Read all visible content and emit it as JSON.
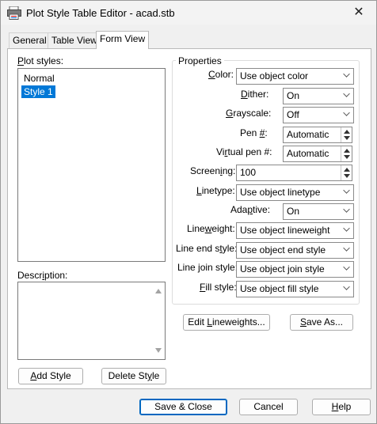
{
  "window": {
    "title": "Plot Style Table Editor - acad.stb",
    "close_glyph": "✕"
  },
  "tabs": [
    {
      "label": "General"
    },
    {
      "label": "Table View"
    },
    {
      "label": "Form View"
    }
  ],
  "plot_styles": {
    "label_u": "P",
    "label_rest": "lot styles:",
    "items": [
      "Normal",
      "Style 1"
    ],
    "selected": "Style 1"
  },
  "description": {
    "label_pre": "Descr",
    "label_u": "i",
    "label_post": "ption:",
    "value": ""
  },
  "left_buttons": {
    "add_u": "A",
    "add_rest": "dd Style",
    "delete_pre": "Delete St",
    "delete_u": "y",
    "delete_post": "le"
  },
  "properties": {
    "title": "Properties",
    "rows": {
      "color": {
        "pre": "",
        "u": "C",
        "post": "olor:",
        "value": "Use object color"
      },
      "dither": {
        "pre": "",
        "u": "D",
        "post": "ither:",
        "value": "On"
      },
      "grayscale": {
        "pre": "",
        "u": "G",
        "post": "rayscale:",
        "value": "Off"
      },
      "pen": {
        "pre": "Pen ",
        "u": "#",
        "post": ":",
        "value": "Automatic"
      },
      "virtual_pen": {
        "pre": "Vi",
        "u": "r",
        "post": "tual pen #:",
        "value": "Automatic"
      },
      "screening": {
        "pre": "Screen",
        "u": "i",
        "post": "ng:",
        "value": "100"
      },
      "linetype": {
        "pre": "",
        "u": "L",
        "post": "inetype:",
        "value": "Use object linetype"
      },
      "adaptive": {
        "pre": "Ada",
        "u": "p",
        "post": "tive:",
        "value": "On"
      },
      "lineweight": {
        "pre": "Line",
        "u": "w",
        "post": "eight:",
        "value": "Use object lineweight"
      },
      "line_end": {
        "pre": "Line end s",
        "u": "t",
        "post": "yle:",
        "value": "Use object end style"
      },
      "line_join": {
        "pre": "Line ",
        "u": "j",
        "post": "oin style:",
        "value": "Use object join style"
      },
      "fill": {
        "pre": "",
        "u": "F",
        "post": "ill style:",
        "value": "Use object fill style"
      }
    }
  },
  "right_buttons": {
    "edit_pre": "Edit ",
    "edit_u": "L",
    "edit_post": "ineweights...",
    "save_as_pre": "",
    "save_as_u": "S",
    "save_as_post": "ave As..."
  },
  "footer": {
    "save_close": "Save & Close",
    "cancel": "Cancel",
    "help_u": "H",
    "help_rest": "elp"
  }
}
